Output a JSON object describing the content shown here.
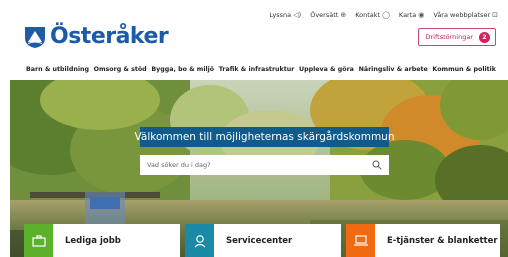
{
  "utility": {
    "items": [
      {
        "label": "Lyssna",
        "icon": "speaker-icon"
      },
      {
        "label": "Översätt",
        "icon": "globe-icon"
      },
      {
        "label": "Kontakt",
        "icon": "chat-icon"
      },
      {
        "label": "Karta",
        "icon": "map-pin-icon"
      },
      {
        "label": "Våra webbplatser",
        "icon": "external-link-icon"
      }
    ]
  },
  "brand": {
    "name": "Österåker",
    "color": "#1d5aa7"
  },
  "disruptions": {
    "label": "Driftstörningar",
    "count": "2",
    "color": "#d4205f"
  },
  "nav": {
    "items": [
      "Barn & utbildning",
      "Omsorg & stöd",
      "Bygga, bo & miljö",
      "Trafik & infrastruktur",
      "Uppleva & göra",
      "Näringsliv & arbete",
      "Kommun & politik"
    ]
  },
  "hero": {
    "welcome": "Välkommen till möjligheternas skärgårdskommun",
    "search_placeholder": "Vad söker du i dag?"
  },
  "cards": [
    {
      "label": "Lediga jobb",
      "icon": "briefcase-icon",
      "color": "#5db12a"
    },
    {
      "label": "Servicecenter",
      "icon": "support-person-icon",
      "color": "#1a8aa6"
    },
    {
      "label": "E-tjänster & blanketter",
      "icon": "laptop-hand-icon",
      "color": "#f06a12"
    }
  ]
}
